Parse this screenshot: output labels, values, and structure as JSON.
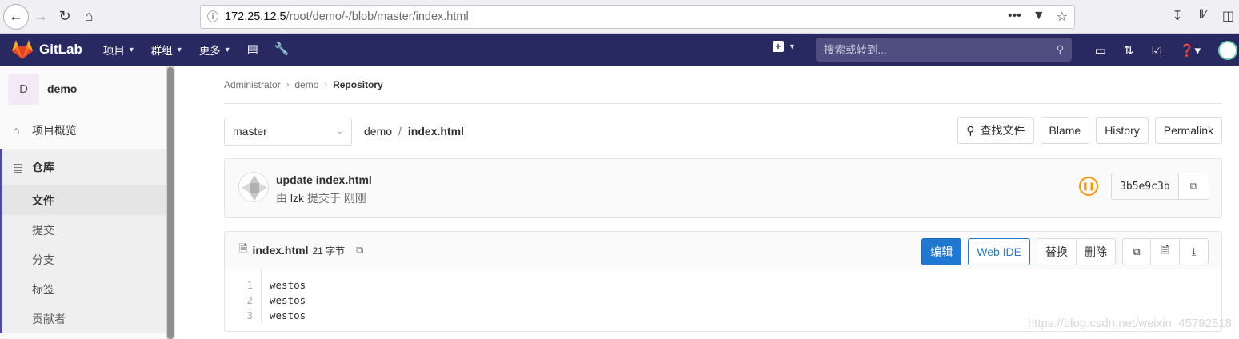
{
  "browser": {
    "url_host": "172.25.12.5",
    "url_path": "/root/demo/-/blob/master/index.html"
  },
  "header": {
    "brand": "GitLab",
    "menu": [
      {
        "label": "项目"
      },
      {
        "label": "群组"
      },
      {
        "label": "更多"
      }
    ],
    "search_placeholder": "搜索或转到..."
  },
  "sidebar": {
    "project_initial": "D",
    "project_name": "demo",
    "overview": "项目概览",
    "repository": "仓库",
    "sub_items": [
      "文件",
      "提交",
      "分支",
      "标签",
      "贡献者"
    ]
  },
  "breadcrumb": [
    "Administrator",
    "demo",
    "Repository"
  ],
  "file_bar": {
    "branch": "master",
    "path_root": "demo",
    "path_sep": "/",
    "path_file": "index.html",
    "find_file": "查找文件",
    "blame": "Blame",
    "history": "History",
    "permalink": "Permalink"
  },
  "commit": {
    "title": "update index.html",
    "by_prefix": "由",
    "author": "lzk",
    "by_suffix": "提交于 刚刚",
    "sha": "3b5e9c3b",
    "pipeline_color": "#fc9403"
  },
  "file": {
    "name": "index.html",
    "size": "21 字节",
    "edit": "编辑",
    "web_ide": "Web IDE",
    "replace": "替换",
    "delete": "删除",
    "line_numbers": [
      "1",
      "2",
      "3"
    ],
    "lines": [
      "westos",
      "westos",
      "westos"
    ]
  },
  "watermark": "https://blog.csdn.net/weixin_45792518",
  "colors": {
    "header_bg": "#292961",
    "primary": "#1f78d1",
    "sidebar_active_border": "#4b4ba3"
  }
}
